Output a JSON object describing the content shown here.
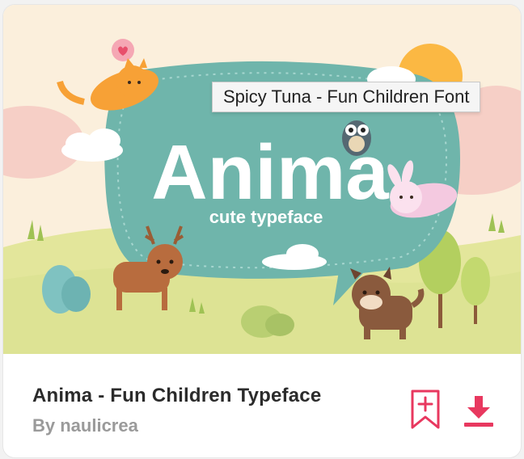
{
  "tooltip": {
    "text": "Spicy Tuna - Fun Children Font"
  },
  "preview": {
    "headline": "Anima",
    "tagline": "cute typeface"
  },
  "font": {
    "title": "Anima - Fun Children Typeface",
    "author": "By naulicrea"
  },
  "actions": {
    "bookmark_icon": "bookmark-add-icon",
    "download_icon": "download-icon",
    "accent_color": "#e8385f"
  }
}
